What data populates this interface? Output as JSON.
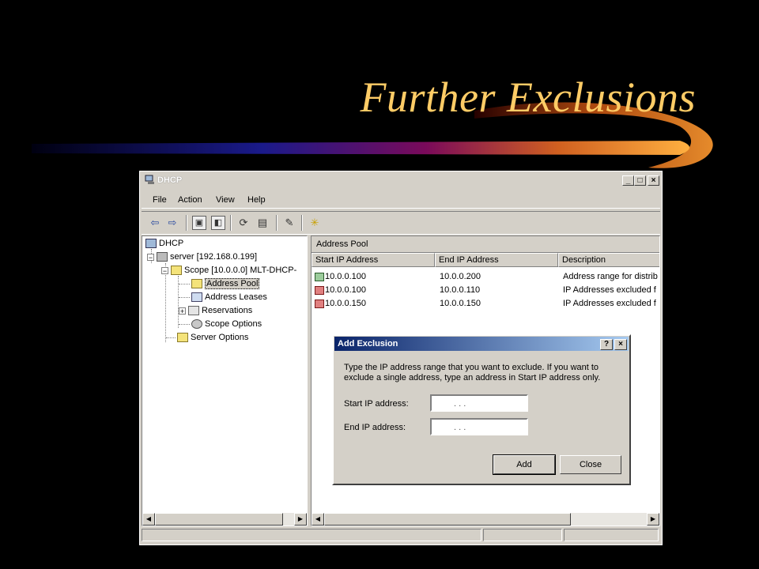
{
  "slide": {
    "title": "Further Exclusions"
  },
  "window": {
    "title": "DHCP",
    "controls": [
      "_",
      "□",
      "×"
    ],
    "menu": [
      "File",
      "Action",
      "View",
      "Help"
    ]
  },
  "tree": {
    "root": "DHCP",
    "server": "server [192.168.0.199]",
    "scope": "Scope [10.0.0.0] MLT-DHCP-",
    "children": [
      "Address Pool",
      "Address Leases",
      "Reservations",
      "Scope Options"
    ],
    "server_options": "Server Options"
  },
  "list": {
    "header": "Address Pool",
    "columns": [
      "Start IP Address",
      "End IP Address",
      "Description"
    ],
    "rows": [
      {
        "start": "10.0.0.100",
        "end": "10.0.0.200",
        "description": "Address range for distrib",
        "icon": "range"
      },
      {
        "start": "10.0.0.100",
        "end": "10.0.0.110",
        "description": "IP Addresses excluded f",
        "icon": "exclusion"
      },
      {
        "start": "10.0.0.150",
        "end": "10.0.0.150",
        "description": "IP Addresses excluded f",
        "icon": "exclusion"
      }
    ]
  },
  "dialog": {
    "title": "Add Exclusion",
    "help_button": "?",
    "close_button": "×",
    "instructions": "Type the IP address range that you want to exclude. If you want to exclude a single address, type an address in Start IP address only.",
    "start_label": "Start IP address:",
    "end_label": "End IP address:",
    "start_value": ".      .      .",
    "end_value": ".      .      .",
    "add_label": "Add",
    "close_label": "Close"
  },
  "colors": {
    "title": "#ffcc66",
    "dialog_title_bar": "#0a246a",
    "window_face": "#d4d0c8"
  }
}
